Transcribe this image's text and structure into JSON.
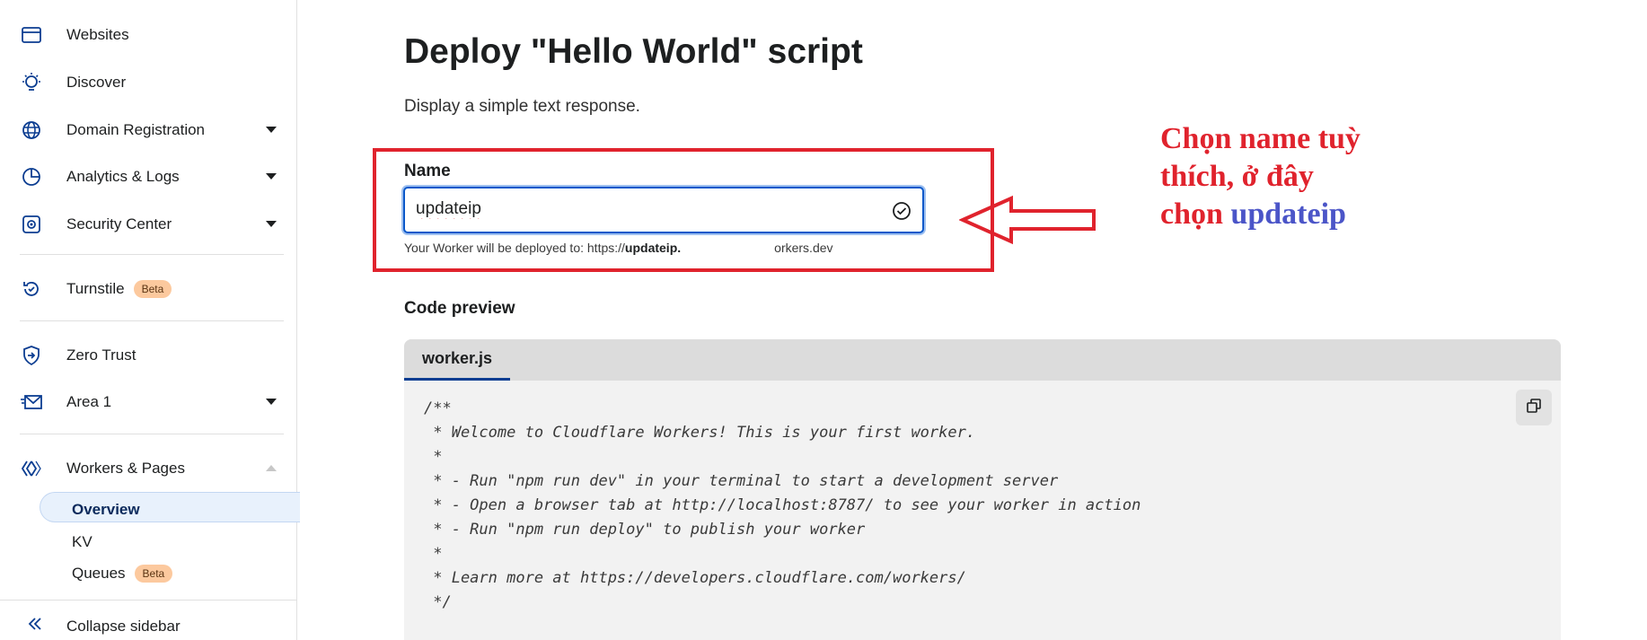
{
  "sidebar": {
    "items": [
      {
        "label": "Websites",
        "icon": "browser-window-icon"
      },
      {
        "label": "Discover",
        "icon": "lightbulb-icon"
      },
      {
        "label": "Domain Registration",
        "icon": "globe-icon",
        "expandable": true
      },
      {
        "label": "Analytics & Logs",
        "icon": "pie-chart-icon",
        "expandable": true
      },
      {
        "label": "Security Center",
        "icon": "security-center-icon",
        "expandable": true
      },
      {
        "label": "Turnstile",
        "icon": "turnstile-icon",
        "badge": "Beta"
      },
      {
        "label": "Zero Trust",
        "icon": "shield-arrow-icon"
      },
      {
        "label": "Area 1",
        "icon": "envelope-icon",
        "expandable": true
      },
      {
        "label": "Workers & Pages",
        "icon": "workers-icon",
        "expanded": true
      }
    ],
    "sub_items": [
      {
        "label": "Overview",
        "active": true
      },
      {
        "label": "KV"
      },
      {
        "label": "Queues",
        "badge": "Beta"
      }
    ],
    "collapse_label": "Collapse sidebar"
  },
  "main": {
    "title": "Deploy \"Hello World\" script",
    "subtitle": "Display a simple text response.",
    "name_label": "Name",
    "name_value": "updateip",
    "deploy_note_prefix": "Your Worker will be deployed to: https://",
    "deploy_note_name": "updateip.",
    "deploy_note_suffix": "orkers.dev",
    "code_preview_label": "Code preview",
    "code_tab": "worker.js",
    "code": "/**\n * Welcome to Cloudflare Workers! This is your first worker.\n *\n * - Run \"npm run dev\" in your terminal to start a development server\n * - Open a browser tab at http://localhost:8787/ to see your worker in action\n * - Run \"npm run deploy\" to publish your worker\n *\n * Learn more at https://developers.cloudflare.com/workers/\n */"
  },
  "annotation": {
    "line1": "Chọn name tuỳ",
    "line2": "thích, ở đây",
    "line3_prefix": "chọn ",
    "line3_highlight": "updateip"
  },
  "colors": {
    "annotation_red": "#e0232d",
    "annotation_blue": "#4b55c8",
    "focus_blue": "#0a58ca",
    "beta_badge": "#fcc99e"
  }
}
